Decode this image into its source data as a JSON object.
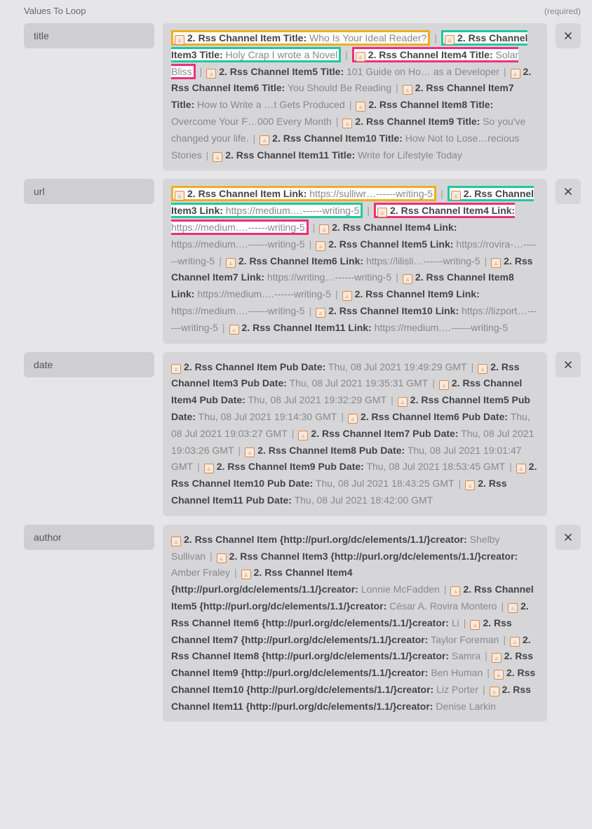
{
  "header": {
    "title": "Values To Loop",
    "required": "(required)"
  },
  "fields": {
    "title": "title",
    "url": "url",
    "date": "date",
    "author": "author"
  },
  "title_items": [
    {
      "label": "2. Rss Channel Item Title:",
      "value": "Who Is Your Ideal Reader?",
      "hl": "yellow"
    },
    {
      "label": "2. Rss Channel Item3 Title:",
      "value": "Holy Crap I wrote a Novel",
      "hl": "teal"
    },
    {
      "label": "2. Rss Channel Item4 Title:",
      "value": "Solar Bliss",
      "hl": "pink"
    },
    {
      "label": "2. Rss Channel Item5 Title:",
      "value": "101 Guide on Ho… as a Developer"
    },
    {
      "label": "2. Rss Channel Item6 Title:",
      "value": "You Should Be Reading"
    },
    {
      "label": "2. Rss Channel Item7 Title:",
      "value": "How to Write a …t Gets Produced"
    },
    {
      "label": "2. Rss Channel Item8 Title:",
      "value": "Overcome Your F…000 Every Month"
    },
    {
      "label": "2. Rss Channel Item9 Title:",
      "value": "So you've changed your life."
    },
    {
      "label": "2. Rss Channel Item10 Title:",
      "value": "How Not to Lose…recious Stories"
    },
    {
      "label": "2. Rss Channel Item11 Title:",
      "value": "Write for Lifestyle Today"
    }
  ],
  "url_items": [
    {
      "label": "2. Rss Channel Item Link:",
      "value": "https://sulliwr…------writing-5",
      "hl": "yellow"
    },
    {
      "label": "2. Rss Channel Item3 Link:",
      "value": "https://medium.…------writing-5",
      "hl": "teal"
    },
    {
      "label": "2. Rss Channel Item4 Link:",
      "value": "https://medium.…------writing-5",
      "hl": "pink"
    },
    {
      "label": "2. Rss Channel Item4 Link:",
      "value": "https://medium.…------writing-5"
    },
    {
      "label": "2. Rss Channel Item5 Link:",
      "value": "https://rovira-…------writing-5"
    },
    {
      "label": "2. Rss Channel Item6 Link:",
      "value": "https://lilisli…------writing-5"
    },
    {
      "label": "2. Rss Channel Item7 Link:",
      "value": "https://writing…------writing-5"
    },
    {
      "label": "2. Rss Channel Item8 Link:",
      "value": "https://medium.…------writing-5"
    },
    {
      "label": "2. Rss Channel Item9 Link:",
      "value": "https://medium.…------writing-5"
    },
    {
      "label": "2. Rss Channel Item10 Link:",
      "value": "https://lizport…------writing-5"
    },
    {
      "label": "2. Rss Channel Item11 Link:",
      "value": "https://medium.…------writing-5"
    }
  ],
  "date_items": [
    {
      "label": "2. Rss Channel Item Pub Date:",
      "value": "Thu, 08 Jul 2021 19:49:29 GMT"
    },
    {
      "label": "2. Rss Channel Item3 Pub Date:",
      "value": "Thu, 08 Jul 2021 19:35:31 GMT"
    },
    {
      "label": "2. Rss Channel Item4 Pub Date:",
      "value": "Thu, 08 Jul 2021 19:32:29 GMT"
    },
    {
      "label": "2. Rss Channel Item5 Pub Date:",
      "value": "Thu, 08 Jul 2021 19:14:30 GMT"
    },
    {
      "label": "2. Rss Channel Item6 Pub Date:",
      "value": "Thu, 08 Jul 2021 19:03:27 GMT"
    },
    {
      "label": "2. Rss Channel Item7 Pub Date:",
      "value": "Thu, 08 Jul 2021 19:03:26 GMT"
    },
    {
      "label": "2. Rss Channel Item8 Pub Date:",
      "value": "Thu, 08 Jul 2021 19:01:47 GMT"
    },
    {
      "label": "2. Rss Channel Item9 Pub Date:",
      "value": "Thu, 08 Jul 2021 18:53:45 GMT"
    },
    {
      "label": "2. Rss Channel Item10 Pub Date:",
      "value": "Thu, 08 Jul 2021 18:43:25 GMT"
    },
    {
      "label": "2. Rss Channel Item11 Pub Date:",
      "value": "Thu, 08 Jul 2021 18:42:00 GMT"
    }
  ],
  "author_items": [
    {
      "label": "2. Rss Channel Item {http://purl.org/dc/elements/1.1/}creator:",
      "value": "Shelby Sullivan"
    },
    {
      "label": "2. Rss Channel Item3 {http://purl.org/dc/elements/1.1/}creator:",
      "value": "Amber Fraley"
    },
    {
      "label": "2. Rss Channel Item4 {http://purl.org/dc/elements/1.1/}creator:",
      "value": "Lonnie McFadden"
    },
    {
      "label": "2. Rss Channel Item5 {http://purl.org/dc/elements/1.1/}creator:",
      "value": "César A. Rovira Montero"
    },
    {
      "label": "2. Rss Channel Item6 {http://purl.org/dc/elements/1.1/}creator:",
      "value": "Li"
    },
    {
      "label": "2. Rss Channel Item7 {http://purl.org/dc/elements/1.1/}creator:",
      "value": "Taylor Foreman"
    },
    {
      "label": "2. Rss Channel Item8 {http://purl.org/dc/elements/1.1/}creator:",
      "value": "Samra"
    },
    {
      "label": "2. Rss Channel Item9 {http://purl.org/dc/elements/1.1/}creator:",
      "value": "Ben Human"
    },
    {
      "label": "2. Rss Channel Item10 {http://purl.org/dc/elements/1.1/}creator:",
      "value": "Liz Porter"
    },
    {
      "label": "2. Rss Channel Item11 {http://purl.org/dc/elements/1.1/}creator:",
      "value": "Denise Larkin"
    }
  ]
}
